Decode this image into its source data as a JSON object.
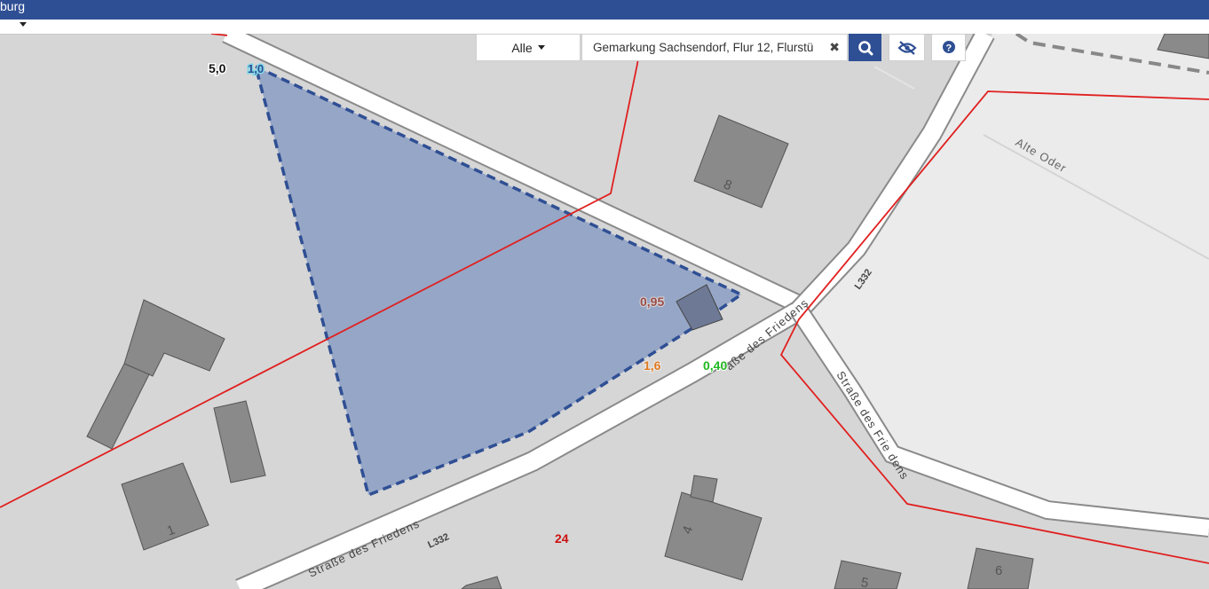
{
  "header": {
    "title": "burg"
  },
  "search": {
    "filter_label": "Alle",
    "query": "Gemarkung Sachsendorf, Flur 12, Flurstü",
    "clear_icon": "close-icon",
    "search_icon": "search-icon",
    "visibility_icon": "eye-slash-icon",
    "help_icon": "question-circle-icon"
  },
  "map": {
    "streets": [
      "Straße des Friedens",
      "Straße des Friedens",
      "aße des Friedens",
      "Straße des Frie dens",
      "L332",
      "L332"
    ],
    "water": "Alte Oder",
    "house_numbers": [
      "8",
      "1",
      "4",
      "5",
      "6"
    ],
    "labels": {
      "dist_top": "5,0",
      "dist_marker": "1,0",
      "dist_a": "0,95",
      "dist_b": "1,6",
      "dist_c": "0,40",
      "parcel": "24"
    },
    "colors": {
      "parcel_boundary": "#e02020",
      "selection_fill": "#8b9dc3",
      "selection_stroke": "#2f4f94"
    }
  }
}
